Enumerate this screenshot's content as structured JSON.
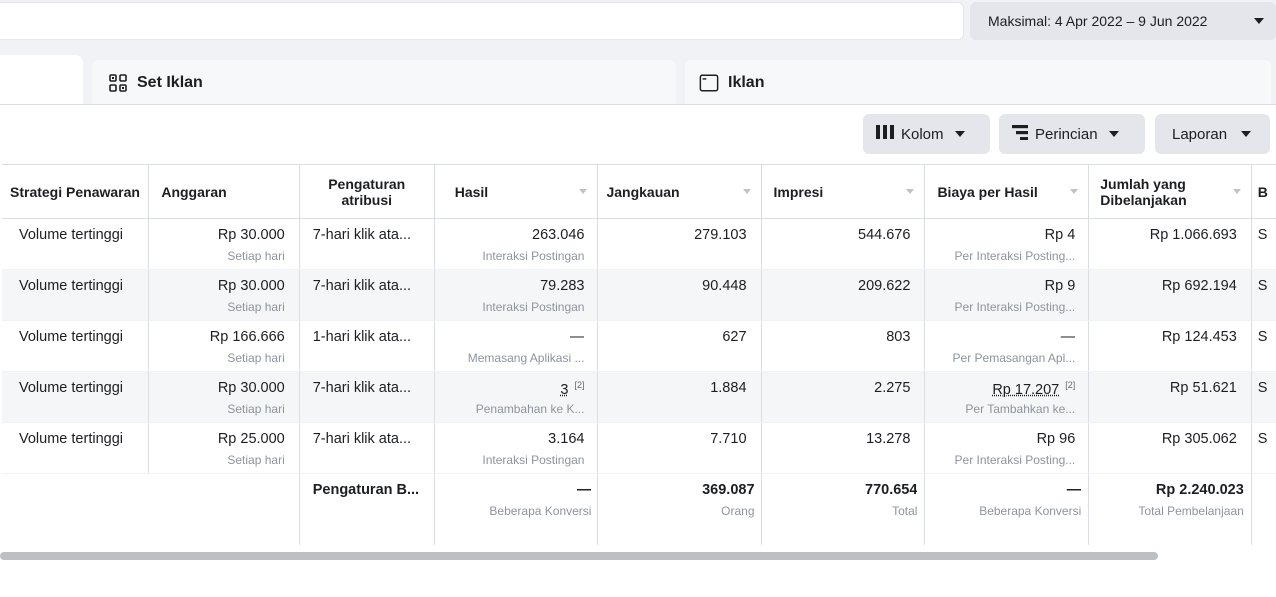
{
  "date_range": {
    "label": "Maksimal: 4 Apr 2022 – 9 Jun 2022"
  },
  "tabs": {
    "adset": "Set Iklan",
    "ad": "Iklan"
  },
  "toolbar": {
    "columns": "Kolom",
    "breakdown": "Perincian",
    "report": "Laporan"
  },
  "table": {
    "headers": {
      "bid": "Strategi Penawaran",
      "budget": "Anggaran",
      "attribution": "Pengaturan atribusi",
      "results": "Hasil",
      "reach": "Jangkauan",
      "impressions": "Impresi",
      "cost": "Biaya per Hasil",
      "spent": "Jumlah yang Dibelanjakan",
      "next": "B"
    },
    "rows": [
      {
        "bid": "Volume tertinggi",
        "budget": "Rp 30.000",
        "budget_sub": "Setiap hari",
        "attribution": "7-hari klik ata...",
        "results": "263.046",
        "results_sub": "Interaksi Postingan",
        "reach": "279.103",
        "impressions": "544.676",
        "cost": "Rp 4",
        "cost_sub": "Per Interaksi Posting...",
        "spent": "Rp 1.066.693",
        "next": "S"
      },
      {
        "bid": "Volume tertinggi",
        "budget": "Rp 30.000",
        "budget_sub": "Setiap hari",
        "attribution": "7-hari klik ata...",
        "results": "79.283",
        "results_sub": "Interaksi Postingan",
        "reach": "90.448",
        "impressions": "209.622",
        "cost": "Rp 9",
        "cost_sub": "Per Interaksi Posting...",
        "spent": "Rp 692.194",
        "next": "S"
      },
      {
        "bid": "Volume tertinggi",
        "budget": "Rp 166.666",
        "budget_sub": "Setiap hari",
        "attribution": "1-hari klik ata...",
        "results": "—",
        "results_sub": "Memasang Aplikasi ...",
        "reach": "627",
        "impressions": "803",
        "cost": "—",
        "cost_sub": "Per Pemasangan Apl...",
        "spent": "Rp 124.453",
        "next": "S"
      },
      {
        "bid": "Volume tertinggi",
        "budget": "Rp 30.000",
        "budget_sub": "Setiap hari",
        "attribution": "7-hari klik ata...",
        "results": "3",
        "results_note": "[2]",
        "results_sub": "Penambahan ke K...",
        "reach": "1.884",
        "impressions": "2.275",
        "cost": "Rp 17.207",
        "cost_note": "[2]",
        "cost_sub": "Per Tambahkan ke...",
        "spent": "Rp 51.621",
        "next": "S"
      },
      {
        "bid": "Volume tertinggi",
        "budget": "Rp 25.000",
        "budget_sub": "Setiap hari",
        "attribution": "7-hari klik ata...",
        "results": "3.164",
        "results_sub": "Interaksi Postingan",
        "reach": "7.710",
        "impressions": "13.278",
        "cost": "Rp 96",
        "cost_sub": "Per Interaksi Posting...",
        "spent": "Rp 305.062",
        "next": "S"
      }
    ],
    "totals": {
      "attribution": "Pengaturan B...",
      "results": "—",
      "results_sub": "Beberapa Konversi",
      "reach": "369.087",
      "reach_sub": "Orang",
      "impressions": "770.654",
      "impressions_sub": "Total",
      "cost": "—",
      "cost_sub": "Beberapa Konversi",
      "spent": "Rp 2.240.023",
      "spent_sub": "Total Pembelanjaan"
    }
  }
}
